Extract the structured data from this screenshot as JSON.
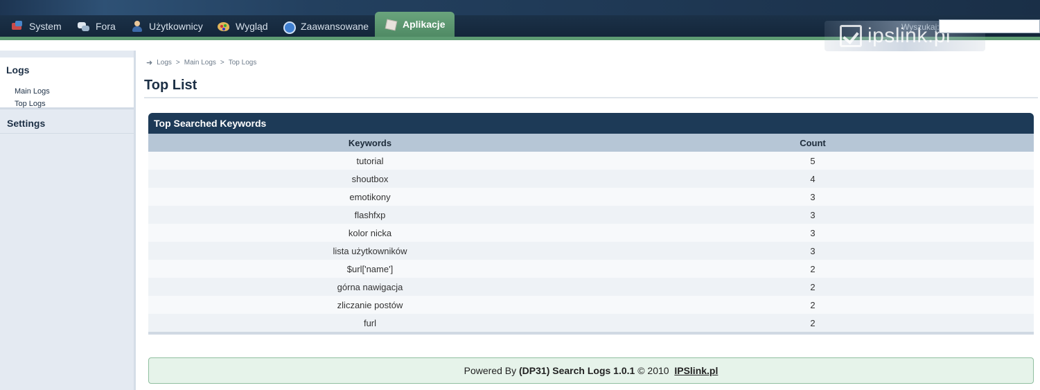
{
  "nav": {
    "tabs": [
      {
        "label": "System",
        "icon": "system-icon"
      },
      {
        "label": "Fora",
        "icon": "forums-icon"
      },
      {
        "label": "Użytkownicy",
        "icon": "users-icon"
      },
      {
        "label": "Wygląd",
        "icon": "palette-icon"
      },
      {
        "label": "Zaawansowane",
        "icon": "advanced-icon"
      },
      {
        "label": "Aplikacje",
        "icon": "apps-icon",
        "active": true
      }
    ],
    "search_label": "Wyszukaj:",
    "search_value": "",
    "watermark": "ipslink.pl"
  },
  "sidebar": {
    "logs_heading": "Logs",
    "items": [
      {
        "label": "Main Logs"
      },
      {
        "label": "Top Logs"
      }
    ],
    "settings_heading": "Settings"
  },
  "breadcrumb": [
    "Logs",
    "Main Logs",
    "Top Logs"
  ],
  "page_title": "Top List",
  "table": {
    "title": "Top Searched Keywords",
    "columns": [
      "Keywords",
      "Count"
    ],
    "rows": [
      {
        "keyword": "tutorial",
        "count": "5"
      },
      {
        "keyword": "shoutbox",
        "count": "4"
      },
      {
        "keyword": "emotikony",
        "count": "3"
      },
      {
        "keyword": "flashfxp",
        "count": "3"
      },
      {
        "keyword": "kolor nicka",
        "count": "3"
      },
      {
        "keyword": "lista użytkowników",
        "count": "3"
      },
      {
        "keyword": "$url['name']",
        "count": "2"
      },
      {
        "keyword": "górna nawigacja",
        "count": "2"
      },
      {
        "keyword": "zliczanie postów",
        "count": "2"
      },
      {
        "keyword": "furl",
        "count": "2"
      }
    ]
  },
  "footer": {
    "prefix": "Powered By",
    "product": "(DP31) Search Logs 1.0.1",
    "copyright": "© 2010",
    "link": "IPSlink.pl"
  },
  "colors": {
    "nav_bg": "#1b3148",
    "accent_green": "#5e9c73",
    "table_header": "#1d3a57",
    "column_header": "#b6c6d6",
    "footer_bg": "#e6f3ea"
  }
}
